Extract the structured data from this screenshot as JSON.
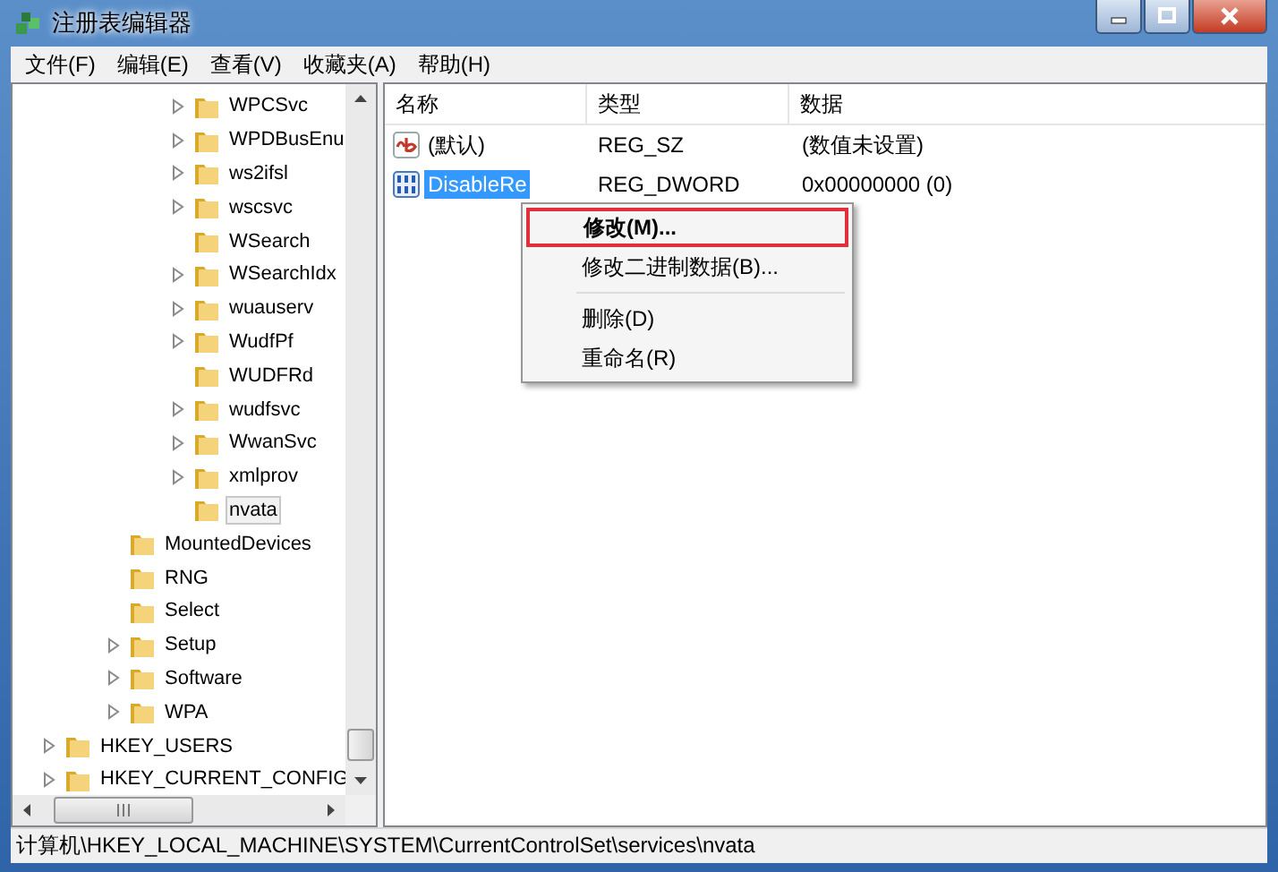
{
  "window": {
    "title": "注册表编辑器"
  },
  "menu_bar": [
    "文件(F)",
    "编辑(E)",
    "查看(V)",
    "收藏夹(A)",
    "帮助(H)"
  ],
  "tree": {
    "items": [
      {
        "children": [
          {
            "children": [
              {
                "label": "WPCSvc",
                "expandable": true,
                "selected": false
              },
              {
                "label": "WPDBusEnu",
                "expandable": true,
                "selected": false
              },
              {
                "label": "ws2ifsl",
                "expandable": true,
                "selected": false
              },
              {
                "label": "wscsvc",
                "expandable": true,
                "selected": false
              },
              {
                "label": "WSearch",
                "expandable": false,
                "selected": false
              },
              {
                "label": "WSearchIdx",
                "expandable": true,
                "selected": false
              },
              {
                "label": "wuauserv",
                "expandable": true,
                "selected": false
              },
              {
                "label": "WudfPf",
                "expandable": true,
                "selected": false
              },
              {
                "label": "WUDFRd",
                "expandable": false,
                "selected": false
              },
              {
                "label": "wudfsvc",
                "expandable": true,
                "selected": false
              },
              {
                "label": "WwanSvc",
                "expandable": true,
                "selected": false
              },
              {
                "label": "xmlprov",
                "expandable": true,
                "selected": false
              },
              {
                "label": "nvata",
                "expandable": false,
                "selected": true
              }
            ]
          },
          {
            "label": "MountedDevices",
            "expandable": false,
            "selected": false
          },
          {
            "label": "RNG",
            "expandable": false,
            "selected": false
          },
          {
            "label": "Select",
            "expandable": false,
            "selected": false
          },
          {
            "label": "Setup",
            "expandable": true,
            "selected": false
          },
          {
            "label": "Software",
            "expandable": true,
            "selected": false
          },
          {
            "label": "WPA",
            "expandable": true,
            "selected": false
          }
        ]
      },
      {
        "label": "HKEY_USERS",
        "expandable": true,
        "selected": false
      },
      {
        "label": "HKEY_CURRENT_CONFIG",
        "expandable": true,
        "selected": false
      }
    ]
  },
  "values": {
    "columns": [
      "名称",
      "类型",
      "数据"
    ],
    "rows": [
      {
        "kind": "string",
        "name": "(默认)",
        "type": "REG_SZ",
        "data": "(数值未设置)",
        "selected": false
      },
      {
        "kind": "binary",
        "name": "DisableRe",
        "type": "REG_DWORD",
        "data": "0x00000000 (0)",
        "selected": true
      }
    ]
  },
  "context_menu": {
    "items": [
      {
        "kind": "item",
        "label": "修改(M)...",
        "default": true,
        "selected": true
      },
      {
        "kind": "item",
        "label": "修改二进制数据(B)...",
        "default": false,
        "selected": false
      },
      {
        "kind": "separator"
      },
      {
        "kind": "item",
        "label": "删除(D)",
        "default": false,
        "selected": false
      },
      {
        "kind": "item",
        "label": "重命名(R)",
        "default": false,
        "selected": false
      }
    ]
  },
  "status_bar": "计算机\\HKEY_LOCAL_MACHINE\\SYSTEM\\CurrentControlSet\\services\\nvata"
}
